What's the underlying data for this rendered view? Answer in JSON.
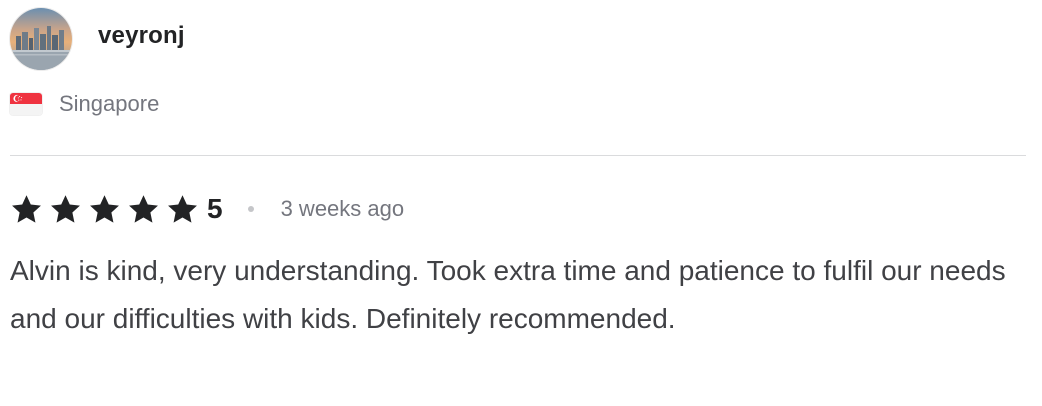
{
  "reviewer": {
    "username": "veyronj",
    "avatar_icon": "avatar-photo-cityscape",
    "country": "Singapore",
    "flag_icon": "singapore-flag-icon"
  },
  "review": {
    "star_icon": "star-icon",
    "stars_filled": 5,
    "stars_total": 5,
    "rating": "5",
    "time_ago": "3 weeks ago",
    "text": "Alvin is kind, very understanding. Took extra time and patience to fulfil our needs and our difficulties with kids. Definitely recommended."
  },
  "colors": {
    "star": "#222325",
    "text_primary": "#222325",
    "text_body": "#404145",
    "text_muted": "#74767e",
    "divider": "#dadbdd",
    "flag_red": "#ef3340"
  }
}
